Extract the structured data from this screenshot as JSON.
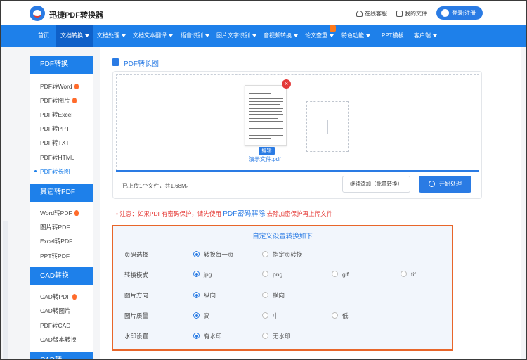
{
  "brand": {
    "name": "迅捷PDF转换器"
  },
  "header": {
    "service": "在线客服",
    "files": "我的文件",
    "login": "登录|注册"
  },
  "nav": [
    "首页",
    "文档转换",
    "文档处理",
    "文档文本翻译",
    "语音识别",
    "图片文字识别",
    "音视频转换",
    "论文查重",
    "特色功能",
    "PPT模板",
    "客户端"
  ],
  "sidebar": {
    "sections": [
      {
        "title": "PDF转换",
        "items": [
          "PDF转Word",
          "PDF转图片",
          "PDF转Excel",
          "PDF转PPT",
          "PDF转TXT",
          "PDF转HTML",
          "PDF转长图"
        ]
      },
      {
        "title": "其它转PDF",
        "items": [
          "Word转PDF",
          "图片转PDF",
          "Excel转PDF",
          "PPT转PDF"
        ]
      },
      {
        "title": "CAD转换",
        "items": [
          "CAD转PDF",
          "CAD转图片",
          "PDF转CAD",
          "CAD版本转换"
        ]
      },
      {
        "title": "CAD转"
      }
    ]
  },
  "page": {
    "title": "PDF转长图"
  },
  "upload": {
    "edit": "编辑",
    "filename": "演示文件.pdf",
    "status": "已上传1个文件，共1.68M。",
    "continue_btn": "继续添加（批量转换）",
    "start_btn": "开始处理"
  },
  "notice": {
    "prefix": "• 注意：如果PDF有密码保护，请先使用",
    "link": "PDF密码解除",
    "suffix": "去除加密保护再上传文件"
  },
  "settings": {
    "title": "自定义设置转换如下",
    "rows": [
      {
        "label": "页码选择",
        "options": [
          "转换每一页",
          "指定页转换"
        ]
      },
      {
        "label": "转换模式",
        "options": [
          "jpg",
          "png",
          "gif",
          "tif"
        ]
      },
      {
        "label": "图片方向",
        "options": [
          "纵向",
          "横向"
        ]
      },
      {
        "label": "图片质量",
        "options": [
          "高",
          "中",
          "低"
        ]
      },
      {
        "label": "水印设置",
        "options": [
          "有水印",
          "无水印"
        ]
      }
    ]
  },
  "colors": {
    "primary": "#1e80ea",
    "accent_border": "#e8662a",
    "warning": "#e53935"
  }
}
